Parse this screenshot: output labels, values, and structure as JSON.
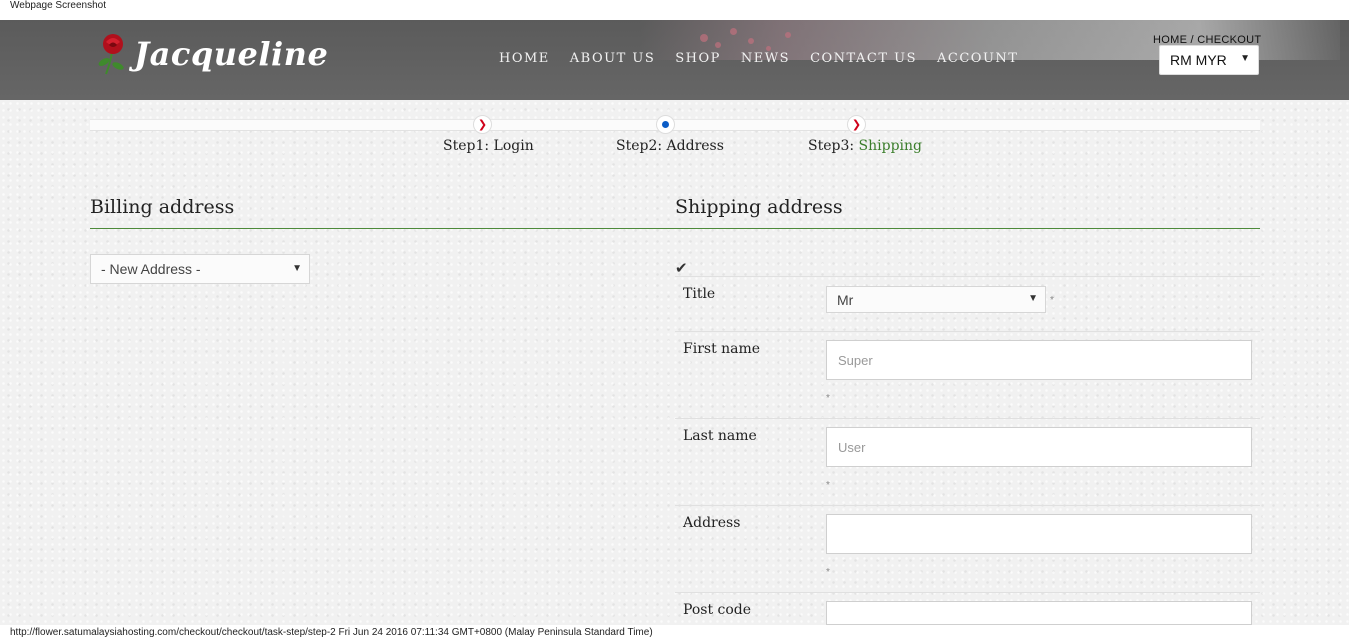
{
  "captions": {
    "top": "Webpage Screenshot",
    "bottom": "http://flower.satumalaysiahosting.com/checkout/checkout/task-step/step-2 Fri Jun 24 2016 07:11:34 GMT+0800 (Malay Peninsula Standard Time)"
  },
  "header": {
    "logo_text": "Jacqueline",
    "nav": [
      "HOME",
      "ABOUT US",
      "SHOP",
      "NEWS",
      "CONTACT US",
      "ACCOUNT"
    ],
    "breadcrumb": "HOME / CHECKOUT",
    "currency": "RM MYR"
  },
  "steps": {
    "step1": "Step1: Login",
    "step2": "Step2: Address",
    "step3_prefix": "Step3: ",
    "step3_highlight": "Shipping"
  },
  "billing": {
    "title": "Billing address",
    "address_select": "- New Address -"
  },
  "shipping": {
    "title": "Shipping address",
    "fields": {
      "title_label": "Title",
      "title_value": "Mr",
      "first_name_label": "First name",
      "first_name_placeholder": "Super",
      "last_name_label": "Last name",
      "last_name_placeholder": "User",
      "address_label": "Address",
      "address_value": "",
      "post_code_label": "Post code"
    },
    "required_mark": "*"
  },
  "colors": {
    "header_bg": "#5f5f5f",
    "accent_green": "#3a7d2a",
    "step_red": "#d0021b",
    "step_blue": "#0b5cc6"
  },
  "icons": [
    "rose-logo-icon",
    "chevron-right-icon",
    "dot-icon",
    "checkmark-icon",
    "dropdown-arrow-icon"
  ]
}
